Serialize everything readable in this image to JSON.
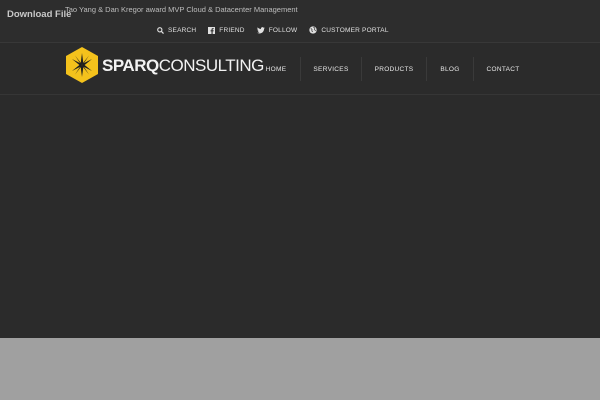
{
  "topbar": {
    "download_label": "Download File",
    "ticker_text": "Tao Yang & Dan Kregor award MVP Cloud & Datacenter Management"
  },
  "utility": {
    "search": {
      "label": "SEARCH",
      "icon": "search-icon"
    },
    "friend": {
      "label": "FRIEND",
      "icon": "facebook-icon"
    },
    "follow": {
      "label": "FOLLOW",
      "icon": "twitter-icon"
    },
    "portal": {
      "label": "CUSTOMER PORTAL",
      "icon": "globe-icon"
    }
  },
  "brand": {
    "name_bold": "SPARQ",
    "name_light": "CONSULTING",
    "logo_color": "#f4c21c",
    "logo_icon": "star-hexagon-icon"
  },
  "nav": {
    "items": [
      "HOME",
      "SERVICES",
      "PRODUCTS",
      "BLOG",
      "CONTACT"
    ]
  },
  "colors": {
    "header_bg": "#2b2b2b",
    "footer_bg": "#a0a0a0",
    "text": "#e8e8e8"
  }
}
